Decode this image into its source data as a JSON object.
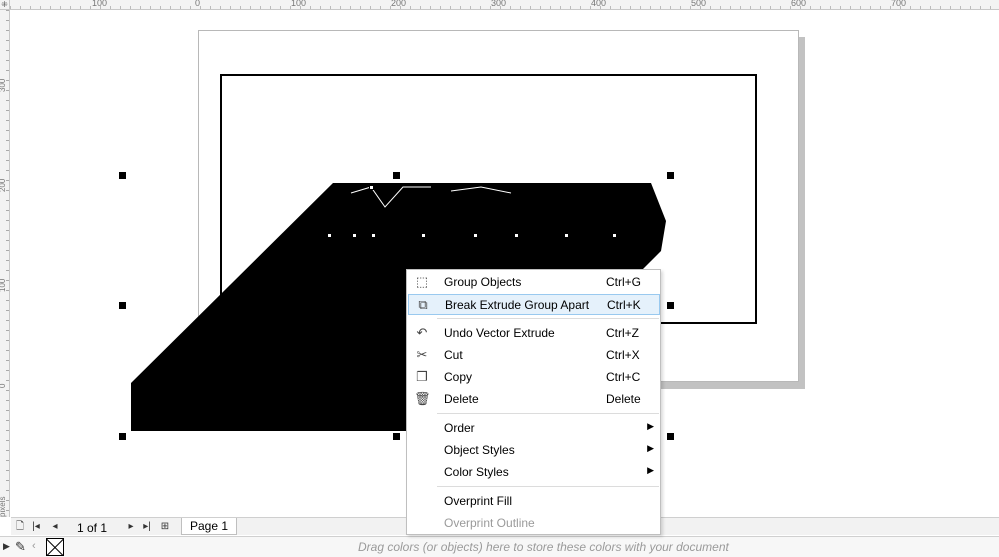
{
  "ruler_top": {
    "labels": [
      "100",
      "0",
      "100",
      "200",
      "300",
      "400",
      "500",
      "600",
      "700"
    ]
  },
  "ruler_left": {
    "labels": [
      "300",
      "200",
      "100",
      "0",
      "pixels"
    ]
  },
  "canvas": {
    "icons": {
      "center_marker": "×"
    }
  },
  "page_bar": {
    "page_count": "1 of 1",
    "page_tab": "Page 1",
    "icons": {
      "add_page": "add-page-icon",
      "first": "|◂",
      "prev": "◂",
      "next": "▸",
      "last": "▸|"
    }
  },
  "palette_bar": {
    "hint": "Drag colors (or objects) here to store these colors with your document"
  },
  "context_menu": {
    "items": [
      {
        "label": "Group Objects",
        "shortcut": "Ctrl+G",
        "icon": "group-objects-icon"
      },
      {
        "label": "Break Extrude Group Apart",
        "shortcut": "Ctrl+K",
        "icon": "break-apart-icon"
      },
      {
        "label": "Undo Vector Extrude",
        "shortcut": "Ctrl+Z",
        "icon": "undo-icon"
      },
      {
        "label": "Cut",
        "shortcut": "Ctrl+X",
        "icon": "scissors-icon"
      },
      {
        "label": "Copy",
        "shortcut": "Ctrl+C",
        "icon": "copy-icon"
      },
      {
        "label": "Delete",
        "shortcut": "Delete",
        "icon": "trash-icon"
      },
      {
        "label": "Order",
        "shortcut": "",
        "icon": ""
      },
      {
        "label": "Object Styles",
        "shortcut": "",
        "icon": ""
      },
      {
        "label": "Color Styles",
        "shortcut": "",
        "icon": ""
      },
      {
        "label": "Overprint Fill",
        "shortcut": "",
        "icon": ""
      },
      {
        "label": "Overprint Outline",
        "shortcut": "",
        "icon": ""
      }
    ]
  }
}
